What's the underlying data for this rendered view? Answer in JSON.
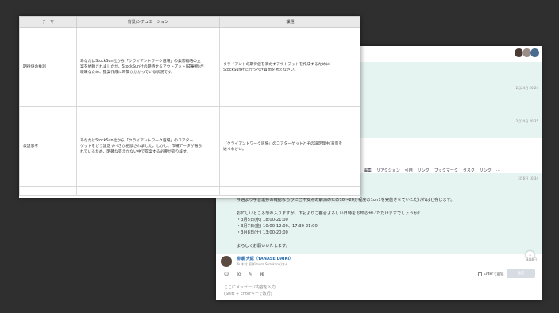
{
  "sheet": {
    "headers": [
      "テーマ",
      "背景/シチュエーション",
      "課題"
    ],
    "rows": [
      {
        "theme": "期待値の推測",
        "background": [
          "あなたはStockSun社から「クライアントワーク道場」の集客戦略の立",
          "案を依頼されましたが、StockSun社の期待するアウトプット(成果物)が",
          "曖昧なため、提案作成に時間がかかっている状況です。"
        ],
        "task": [
          "クライアントの期待値を満たすアウトプットを作成するために",
          "StockSun社に行うべき質問を考えなさい。"
        ]
      },
      {
        "theme": "仮説思考",
        "background": [
          "あなたはStockSun社から「クライアントワーク道場」のコアター",
          "ゲットをどう設定すべきか相談されました。しかし、市場データが限ら",
          "れているため、明確な答えがない中で提案する必要があります。"
        ],
        "task": [
          "「クライアントワーク道場」のコアターゲットとその設定理由(背景を",
          "述べなさい。"
        ]
      }
    ]
  },
  "chat": {
    "timestamps": [
      "2月24日 20:24",
      "2月24日 20:35",
      "3月6日 10:34"
    ],
    "toolbar": [
      "編集",
      "リアクション",
      "引用",
      "リンク",
      "ブックマーク",
      "タスク",
      "リンク",
      "…"
    ],
    "message_lines": [
      "今週より学習進捗の確認ならびにご不安点の解消のため10〜20分程度の1on1を実施させていただければと存じます。",
      "",
      "お忙しいところ恐れ入りますが、下記よりご都合よろしい日時をお知らせいただけますでしょうか？",
      "・3月5日(水) 18:00-21:00",
      "・3月7日(金) 10:00-12:00、17:30-21:00",
      "・3月8日(土) 13:00-20:00",
      "",
      "よろしくお願いいたします。"
    ],
    "sender_name": "柳瀬 大紀（YANASE DAIKI）",
    "sender_sub": "To 木村 凛(Kimura Suzukane)さん",
    "unread_label": "3月6日",
    "enter_label": "Enterで送信",
    "send_label": "送信",
    "input_placeholder": [
      "ここにメッセージ内容を入力",
      "(Shift + Enterキーで改行)"
    ],
    "scroll_icon": "↓"
  }
}
